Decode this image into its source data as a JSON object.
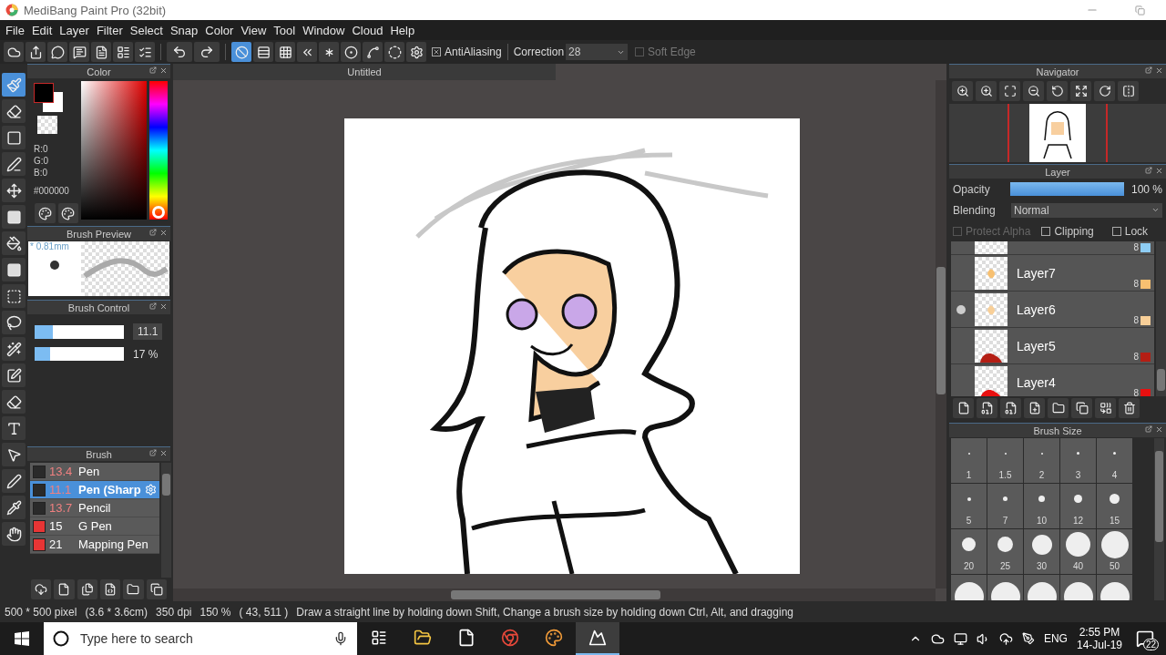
{
  "window": {
    "title": "MediBang Paint Pro (32bit)"
  },
  "menu": [
    "File",
    "Edit",
    "Layer",
    "Filter",
    "Select",
    "Snap",
    "Color",
    "View",
    "Tool",
    "Window",
    "Cloud",
    "Help"
  ],
  "toolbar": {
    "snap_modes": [
      {
        "selected": true
      },
      {
        "selected": false
      },
      {
        "selected": false
      },
      {
        "selected": false
      },
      {
        "selected": false
      },
      {
        "selected": false
      },
      {
        "selected": false
      },
      {
        "selected": false
      }
    ],
    "antialiasing": {
      "label": "AntiAliasing",
      "checked": true
    },
    "correction": {
      "label": "Correction",
      "value": "28"
    },
    "soft_edge": {
      "label": "Soft Edge",
      "checked": false
    }
  },
  "tools": [
    {
      "selected": true
    },
    {
      "selected": false
    },
    {
      "selected": false
    },
    {
      "selected": false
    },
    {
      "selected": false
    },
    {
      "selected": false
    },
    {
      "selected": false
    },
    {
      "selected": false
    },
    {
      "selected": false
    },
    {
      "selected": false
    },
    {
      "selected": false
    },
    {
      "selected": false
    },
    {
      "selected": false
    },
    {
      "selected": false
    },
    {
      "selected": false
    },
    {
      "selected": false
    },
    {
      "selected": false
    },
    {
      "selected": false
    }
  ],
  "color_panel": {
    "title": "Color",
    "rgb": [
      "R:0",
      "G:0",
      "B:0"
    ],
    "hex": "#000000",
    "hue": {
      "level": 0
    }
  },
  "brush_preview": {
    "title": "Brush Preview",
    "size": "* 0.81mm"
  },
  "brush_control": {
    "title": "Brush Control",
    "sliders": [
      {
        "kind": "size",
        "level": 0.2,
        "reading": "11.1"
      },
      {
        "kind": "opacity",
        "level": 0.17,
        "reading": "17 %"
      }
    ]
  },
  "brush_panel": {
    "title": "Brush",
    "items": [
      {
        "size": "13.4",
        "name": "Pen",
        "color": "#2a2a2a",
        "size_highlighted": true,
        "selected": false
      },
      {
        "size": "11.1",
        "name": "Pen (Sharp",
        "color": "#2a2a2a",
        "size_highlighted": true,
        "selected": true
      },
      {
        "size": "13.7",
        "name": "Pencil",
        "color": "#2a2a2a",
        "size_highlighted": true,
        "selected": false
      },
      {
        "size": "15",
        "name": "G Pen",
        "color": "#e83535",
        "size_highlighted": false,
        "selected": false
      },
      {
        "size": "21",
        "name": "Mapping Pen",
        "color": "#e83535",
        "size_highlighted": false,
        "selected": false
      }
    ]
  },
  "canvas": {
    "tab": "Untitled"
  },
  "navigator": {
    "title": "Navigator"
  },
  "layer_panel": {
    "title": "Layer",
    "opacity": {
      "label": "Opacity",
      "level": 1,
      "reading": "100 %"
    },
    "blending": {
      "label": "Blending",
      "value": "Normal"
    },
    "options": [
      {
        "label": "Protect Alpha",
        "checked": false,
        "disabled": true
      },
      {
        "label": "Clipping",
        "checked": false,
        "disabled": false
      },
      {
        "label": "Lock",
        "checked": false,
        "disabled": false
      }
    ],
    "layers": [
      {
        "bits": "8",
        "color": "#8ecdf4",
        "selected": false
      },
      {
        "name": "Layer7",
        "bits": "8",
        "color": "#f7c071",
        "selected": false
      },
      {
        "name": "Layer6",
        "bits": "8",
        "color": "#f8cf98",
        "selected": true
      },
      {
        "name": "Layer5",
        "bits": "8",
        "color": "#b41e14",
        "selected": false
      },
      {
        "name": "Layer4",
        "bits": "8",
        "color": "#e81010",
        "selected": false
      }
    ]
  },
  "brush_size": {
    "title": "Brush Size",
    "sizes": [
      "1",
      "1.5",
      "2",
      "3",
      "4",
      "5",
      "7",
      "10",
      "12",
      "15",
      "20",
      "25",
      "30",
      "40",
      "50"
    ]
  },
  "status_bar": [
    "500 * 500 pixel",
    "(3.6 * 3.6cm)",
    "350 dpi",
    "150 %",
    "( 43, 511 )",
    "Draw a straight line by holding down Shift, Change a brush size by holding down Ctrl, Alt, and dragging"
  ],
  "taskbar": {
    "search": {
      "placeholder": "Type here to search"
    },
    "apps": [
      {
        "selected": false
      },
      {
        "selected": false
      },
      {
        "selected": false
      },
      {
        "selected": false
      },
      {
        "selected": true
      }
    ],
    "language": "ENG",
    "time": "2:55 PM",
    "date": "14-Jul-19",
    "notifications": "22"
  }
}
